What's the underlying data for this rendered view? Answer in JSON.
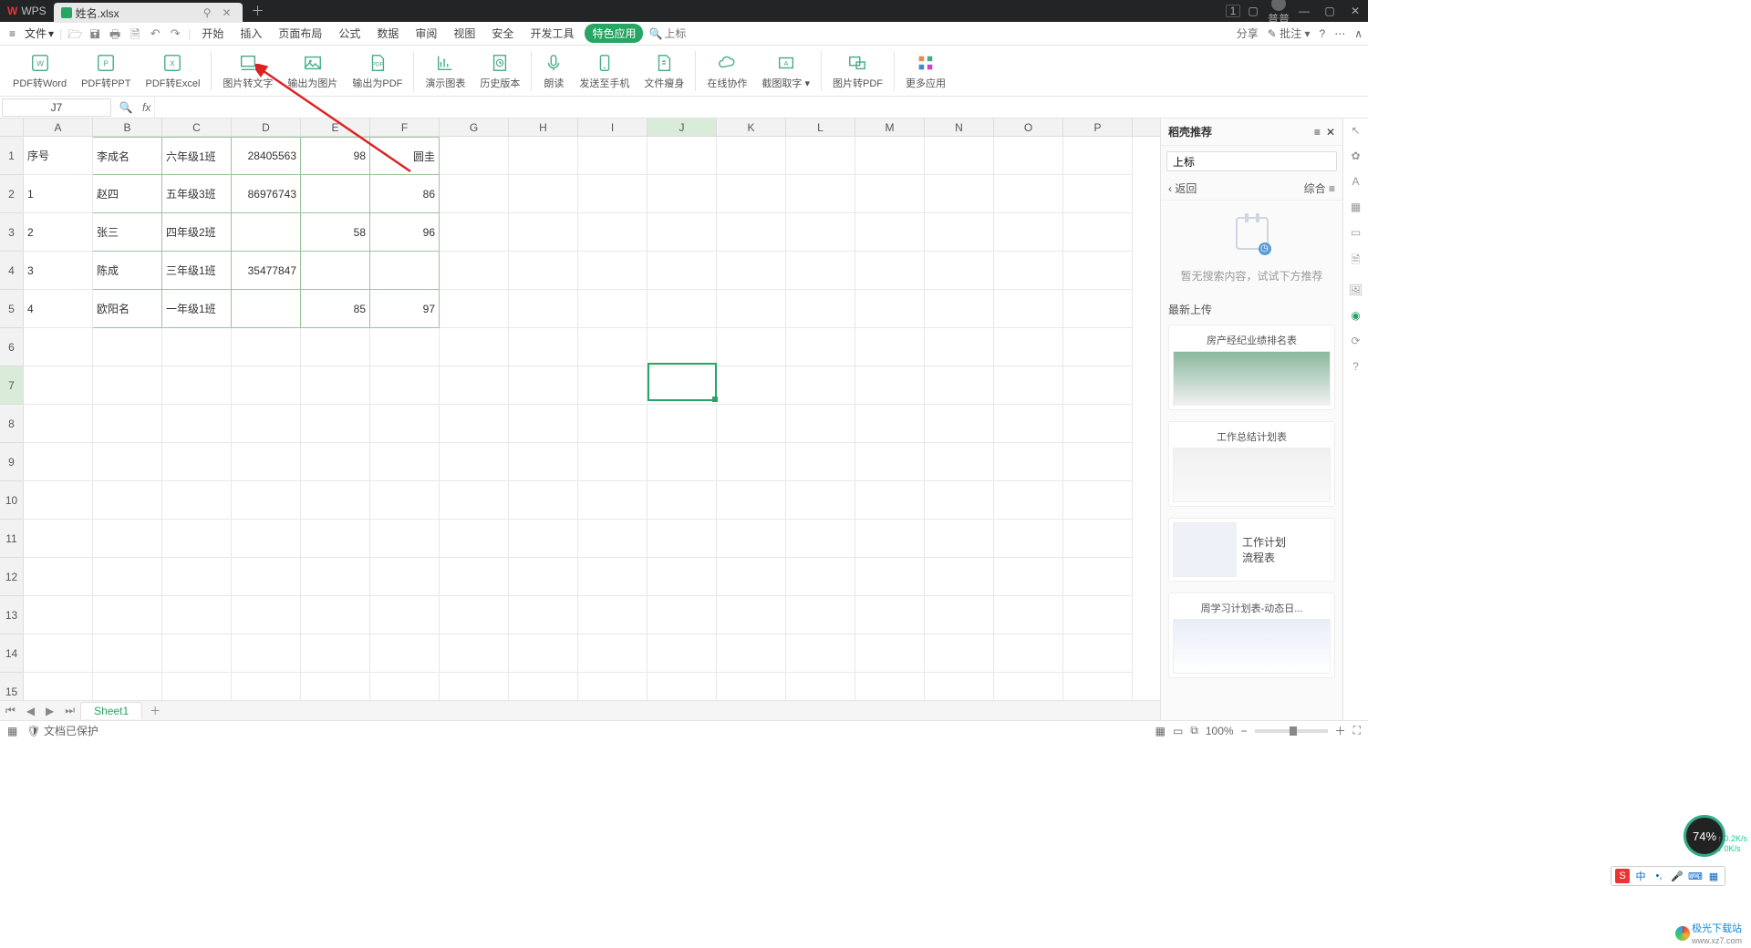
{
  "titlebar": {
    "app": "WPS",
    "filename": "姓名.xlsx",
    "user": "普普"
  },
  "quickaccess": {
    "file_label": "文件"
  },
  "menu": {
    "items": [
      "开始",
      "插入",
      "页面布局",
      "公式",
      "数据",
      "审阅",
      "视图",
      "安全",
      "开发工具"
    ],
    "active": "特色应用",
    "search_placeholder": "上标",
    "share": "分享",
    "comment": "批注"
  },
  "ribbon": {
    "btns": [
      {
        "label": "PDF转Word"
      },
      {
        "label": "PDF转PPT"
      },
      {
        "label": "PDF转Excel"
      },
      {
        "label": "图片转文字"
      },
      {
        "label": "输出为图片"
      },
      {
        "label": "输出为PDF"
      },
      {
        "label": "演示图表"
      },
      {
        "label": "历史版本"
      },
      {
        "label": "朗读"
      },
      {
        "label": "发送至手机"
      },
      {
        "label": "文件瘦身"
      },
      {
        "label": "在线协作"
      },
      {
        "label": "截图取字"
      },
      {
        "label": "图片转PDF"
      },
      {
        "label": "更多应用"
      }
    ]
  },
  "namebox": "J7",
  "columns": [
    "A",
    "B",
    "C",
    "D",
    "E",
    "F",
    "G",
    "H",
    "I",
    "J",
    "K",
    "L",
    "M",
    "N",
    "O",
    "P"
  ],
  "row_headers": [
    "1",
    "2",
    "3",
    "4",
    "5",
    "6",
    "7",
    "8",
    "9",
    "10",
    "11",
    "12",
    "13",
    "14",
    "15"
  ],
  "cells": {
    "r1": {
      "A": "序号",
      "B": "李成名",
      "C": "六年级1班",
      "D": "28405563",
      "E": "98",
      "F": "圆圭"
    },
    "r2": {
      "A": "1",
      "B": "赵四",
      "C": "五年级3班",
      "D": "86976743",
      "E": "",
      "F": "86"
    },
    "r3": {
      "A": "2",
      "B": "张三",
      "C": "四年级2班",
      "D": "",
      "E": "58",
      "F": "96"
    },
    "r4": {
      "A": "3",
      "B": "陈成",
      "C": "三年级1班",
      "D": "35477847",
      "E": "",
      "F": ""
    },
    "r5": {
      "A": "4",
      "B": "欧阳名",
      "C": "一年级1班",
      "D": "",
      "E": "85",
      "F": "97"
    }
  },
  "sheet_tab": "Sheet1",
  "status": {
    "protected": "文档已保护",
    "zoom": "100%"
  },
  "sidepanel": {
    "title": "稻壳推荐",
    "search_placeholder": "上标",
    "back": "返回",
    "all": "综合",
    "empty": "暂无搜索内容，试试下方推荐",
    "section": "最新上传",
    "cards": [
      {
        "title": "房产经纪业绩排名表"
      },
      {
        "title": "工作总结计划表"
      },
      {
        "title": "工作计划\n流程表"
      },
      {
        "title": "周学习计划表-动态日..."
      }
    ]
  },
  "gauge": "74%",
  "net": {
    "up": "0.2K/s",
    "down": "0K/s"
  },
  "watermark": {
    "name": "极光下载站",
    "url": "www.xz7.com"
  },
  "ime": {
    "zh": "中"
  }
}
